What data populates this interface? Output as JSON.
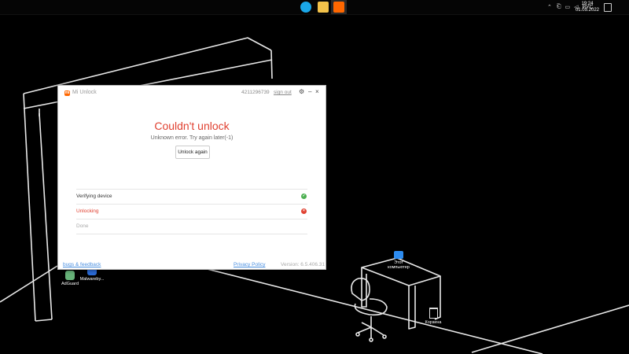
{
  "taskbar": {
    "apps": [
      {
        "icon": "edge-icon",
        "color": "#1aa7e8"
      },
      {
        "icon": "file-explorer-icon",
        "color": "#f2c24a"
      },
      {
        "icon": "mi-unlock-taskbar-icon",
        "color": "#ff6700"
      }
    ],
    "tray_language": "РУС",
    "time": "19:24",
    "date": "01.05.2022"
  },
  "desktop": {
    "icons": [
      {
        "label": "AdGuard"
      },
      {
        "label": "Malwareby..."
      },
      {
        "label": "Этот компьютер"
      },
      {
        "label": "Корзина"
      }
    ]
  },
  "window": {
    "title": "Mi Unlock",
    "account_id": "4211296739",
    "sign_out": "sign out",
    "heading": "Couldn't unlock",
    "subtitle": "Unknown error. Try again later(-1)",
    "button_label": "Unlock again",
    "steps": [
      {
        "label": "Verifying device",
        "status": "success",
        "color": "#4caf50"
      },
      {
        "label": "Unlocking",
        "status": "error",
        "color": "#e04131"
      },
      {
        "label": "Done",
        "status": "pending",
        "color": "#aaaaaa"
      }
    ],
    "footer": {
      "bugs_feedback": "bugs & feedback",
      "privacy_policy": "Privacy Policy",
      "version": "Version: 6.5.406.31"
    }
  },
  "colors": {
    "accent": "#ff6700",
    "error": "#e04131",
    "link": "#4a8fe0"
  }
}
